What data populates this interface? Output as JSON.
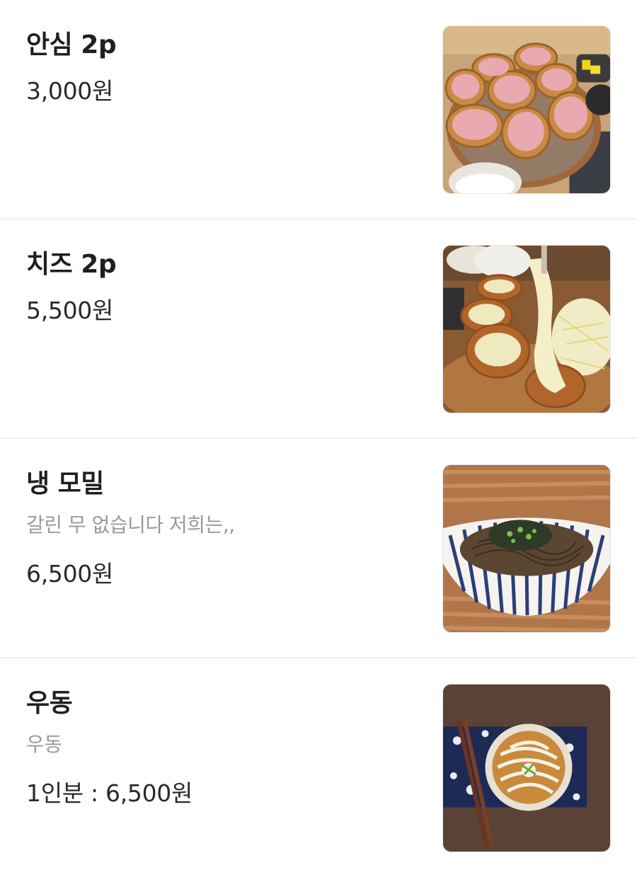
{
  "menu": {
    "items": [
      {
        "name": "안심 2p",
        "description": "",
        "price": "3,000원",
        "image_icon": "fried-pork-cutlet-photo"
      },
      {
        "name": "치즈 2p",
        "description": "",
        "price": "5,500원",
        "image_icon": "cheese-cutlet-photo"
      },
      {
        "name": "냉 모밀",
        "description": "갈린 무 없습니다 저희는,,",
        "price": "6,500원",
        "image_icon": "cold-soba-photo"
      },
      {
        "name": "우동",
        "description": "우동",
        "price": "1인분 : 6,500원",
        "image_icon": "udon-photo"
      }
    ]
  },
  "colors": {
    "text_primary": "#1f1f1f",
    "text_secondary": "#9a9a9a",
    "divider": "#efefef"
  }
}
